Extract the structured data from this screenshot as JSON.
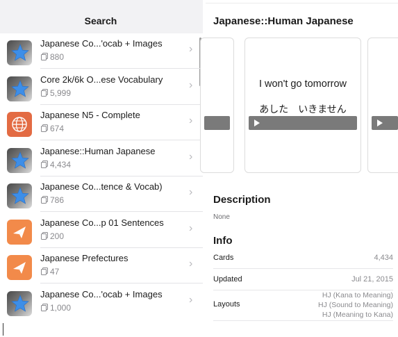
{
  "left": {
    "title": "Search",
    "decks": [
      {
        "title": "Japanese Co...'ocab + Images",
        "count": "880",
        "icon": "anki-star-icon"
      },
      {
        "title": "Core 2k/6k O...ese Vocabulary",
        "count": "5,999",
        "icon": "anki-star-icon"
      },
      {
        "title": "Japanese N5 - Complete",
        "count": "674",
        "icon": "globe-icon"
      },
      {
        "title": "Japanese::Human Japanese",
        "count": "4,434",
        "icon": "anki-star-icon"
      },
      {
        "title": "Japanese Co...tence & Vocab)",
        "count": "786",
        "icon": "anki-star-icon"
      },
      {
        "title": "Japanese Co...p 01 Sentences",
        "count": "200",
        "icon": "paper-plane-icon"
      },
      {
        "title": "Japanese Prefectures",
        "count": "47",
        "icon": "paper-plane-icon"
      },
      {
        "title": "Japanese Co...'ocab + Images",
        "count": "1,000",
        "icon": "anki-star-icon"
      }
    ]
  },
  "right": {
    "title": "Japanese::Human Japanese",
    "card": {
      "front": "I won't go tomorrow",
      "back": "あした　いきません"
    },
    "description": {
      "heading": "Description",
      "value": "None"
    },
    "info": {
      "heading": "Info",
      "cards_label": "Cards",
      "cards_value": "4,434",
      "updated_label": "Updated",
      "updated_value": "Jul 21, 2015",
      "layouts_label": "Layouts",
      "layouts": [
        "HJ (Kana to Meaning)",
        "HJ (Sound to Meaning)",
        "HJ (Meaning to Kana)"
      ]
    }
  },
  "colors": {
    "separator": "#e3e3e6",
    "secondary_text": "#8a8a8e",
    "player_bar": "#7a7a7a",
    "globe_icon_bg": "#e36b43",
    "plane_icon_bg": "#f28a4a"
  }
}
